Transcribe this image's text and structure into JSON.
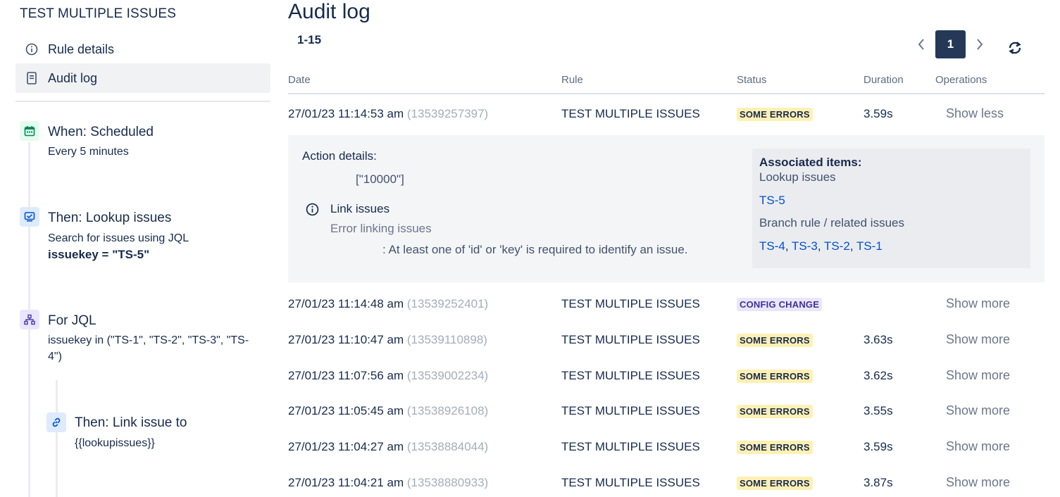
{
  "sidebar": {
    "rule_title": "TEST MULTIPLE ISSUES",
    "nav": [
      {
        "label": "Rule details",
        "icon": "info-icon"
      },
      {
        "label": "Audit log",
        "icon": "document-icon"
      }
    ],
    "steps": {
      "trigger": {
        "title": "When: Scheduled",
        "sub": "Every 5 minutes",
        "icon": "calendar-icon",
        "color": "#00875a"
      },
      "lookup": {
        "title": "Then: Lookup issues",
        "sub": "Search for issues using JQL",
        "jql": "issuekey = \"TS-5\"",
        "icon": "monitor-icon",
        "color": "#0052cc"
      },
      "branch": {
        "title": "For JQL",
        "sub": "issuekey in (\"TS-1\", \"TS-2\", \"TS-3\", \"TS-4\")",
        "icon": "branch-icon",
        "color": "#5243aa"
      },
      "link": {
        "title": "Then: Link issue to",
        "sub": "{{lookupissues}}",
        "icon": "link-icon",
        "color": "#0052cc"
      }
    }
  },
  "main": {
    "title": "Audit log",
    "range": "1-15",
    "pager": {
      "current": "1",
      "prev": "‹",
      "next": "›"
    },
    "columns": {
      "date": "Date",
      "rule": "Rule",
      "status": "Status",
      "duration": "Duration",
      "operations": "Operations"
    },
    "rows": [
      {
        "date": "27/01/23 11:14:53 am",
        "id": "(13539257397)",
        "rule": "TEST MULTIPLE ISSUES",
        "status": "SOME ERRORS",
        "status_kind": "err",
        "duration": "3.59s",
        "op": "Show less"
      },
      {
        "date": "27/01/23 11:14:48 am",
        "id": "(13539252401)",
        "rule": "TEST MULTIPLE ISSUES",
        "status": "CONFIG CHANGE",
        "status_kind": "cfg",
        "duration": "",
        "op": "Show more"
      },
      {
        "date": "27/01/23 11:10:47 am",
        "id": "(13539110898)",
        "rule": "TEST MULTIPLE ISSUES",
        "status": "SOME ERRORS",
        "status_kind": "err",
        "duration": "3.63s",
        "op": "Show more"
      },
      {
        "date": "27/01/23 11:07:56 am",
        "id": "(13539002234)",
        "rule": "TEST MULTIPLE ISSUES",
        "status": "SOME ERRORS",
        "status_kind": "err",
        "duration": "3.62s",
        "op": "Show more"
      },
      {
        "date": "27/01/23 11:05:45 am",
        "id": "(13538926108)",
        "rule": "TEST MULTIPLE ISSUES",
        "status": "SOME ERRORS",
        "status_kind": "err",
        "duration": "3.55s",
        "op": "Show more"
      },
      {
        "date": "27/01/23 11:04:27 am",
        "id": "(13538884044)",
        "rule": "TEST MULTIPLE ISSUES",
        "status": "SOME ERRORS",
        "status_kind": "err",
        "duration": "3.59s",
        "op": "Show more"
      },
      {
        "date": "27/01/23 11:04:21 am",
        "id": "(13538880933)",
        "rule": "TEST MULTIPLE ISSUES",
        "status": "SOME ERRORS",
        "status_kind": "err",
        "duration": "3.87s",
        "op": "Show more"
      }
    ],
    "details": {
      "action_heading": "Action details:",
      "action_value": "[\"10000\"]",
      "link_title": "Link issues",
      "link_error": "Error linking issues",
      "link_message": ": At least one of 'id' or 'key' is required to identify an issue.",
      "assoc_heading": "Associated items:",
      "assoc_lookup_label": "Lookup issues",
      "assoc_lookup_items": [
        "TS-5"
      ],
      "assoc_branch_label": "Branch rule / related issues",
      "assoc_branch_items": [
        "TS-4",
        "TS-3",
        "TS-2",
        "TS-1"
      ]
    }
  },
  "colors": {
    "primary": "#253858",
    "link": "#0052cc",
    "error_badge": "#fff0b3",
    "config_badge": "#eae6ff"
  }
}
